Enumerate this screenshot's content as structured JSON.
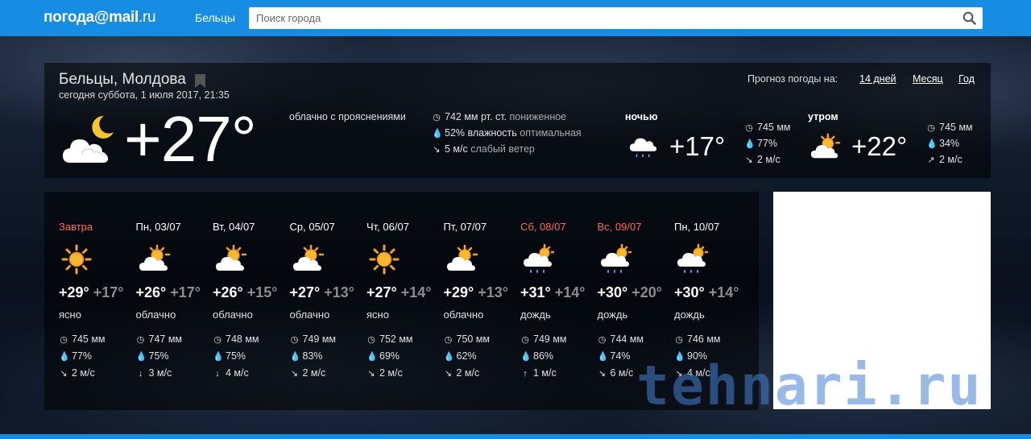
{
  "header": {
    "logo": "погода@mail",
    "logo_suffix": ".ru",
    "city_link": "Бельцы",
    "search_placeholder": "Поиск города"
  },
  "current": {
    "location": "Бельцы, Молдова",
    "date": "сегодня суббота, 1 июля 2017, 21:35",
    "temp": "+27°",
    "condition": "облачно с прояснениями",
    "pressure": "742 мм рт. ст.",
    "pressure_q": "пониженное",
    "humidity": "52% влажность",
    "humidity_q": "оптимальная",
    "wind": "5 м/с",
    "wind_q": "слабый ветер",
    "icon": "partly-cloudy-night-icon"
  },
  "forecast_nav": {
    "label": "Прогноз погоды на:",
    "links": [
      "14 дней",
      "Месяц",
      "Год"
    ]
  },
  "periods": [
    {
      "label": "ночью",
      "temp": "+17°",
      "pressure": "745 мм",
      "humidity": "77%",
      "wind": "2 м/с",
      "wind_arrow": "↘",
      "icon": "cloud-rain-icon"
    },
    {
      "label": "утром",
      "temp": "+22°",
      "pressure": "745 мм",
      "humidity": "34%",
      "wind": "2 м/с",
      "wind_arrow": "↗",
      "icon": "sun-cloud-icon"
    }
  ],
  "days": [
    {
      "name": "Завтра",
      "red": true,
      "hi": "+29°",
      "lo": "+17°",
      "cond": "ясно",
      "icon": "sun",
      "pressure": "745 мм",
      "humidity": "77%",
      "wind": "2 м/с",
      "arrow": "↘"
    },
    {
      "name": "Пн, 03/07",
      "red": false,
      "hi": "+26°",
      "lo": "+17°",
      "cond": "облачно",
      "icon": "suncloud",
      "pressure": "747 мм",
      "humidity": "75%",
      "wind": "3 м/с",
      "arrow": "↓"
    },
    {
      "name": "Вт, 04/07",
      "red": false,
      "hi": "+26°",
      "lo": "+15°",
      "cond": "облачно",
      "icon": "suncloud",
      "pressure": "748 мм",
      "humidity": "75%",
      "wind": "4 м/с",
      "arrow": "↓"
    },
    {
      "name": "Ср, 05/07",
      "red": false,
      "hi": "+27°",
      "lo": "+13°",
      "cond": "облачно",
      "icon": "suncloud",
      "pressure": "749 мм",
      "humidity": "83%",
      "wind": "2 м/с",
      "arrow": "↘"
    },
    {
      "name": "Чт, 06/07",
      "red": false,
      "hi": "+27°",
      "lo": "+14°",
      "cond": "ясно",
      "icon": "sun",
      "pressure": "752 мм",
      "humidity": "69%",
      "wind": "2 м/с",
      "arrow": "↘"
    },
    {
      "name": "Пт, 07/07",
      "red": false,
      "hi": "+29°",
      "lo": "+13°",
      "cond": "облачно",
      "icon": "suncloud",
      "pressure": "750 мм",
      "humidity": "62%",
      "wind": "2 м/с",
      "arrow": "↘"
    },
    {
      "name": "Сб, 08/07",
      "red": true,
      "hi": "+31°",
      "lo": "+14°",
      "cond": "дождь",
      "icon": "rain",
      "pressure": "749 мм",
      "humidity": "86%",
      "wind": "1 м/с",
      "arrow": "↑"
    },
    {
      "name": "Вс, 09/07",
      "red": true,
      "hi": "+30°",
      "lo": "+20°",
      "cond": "дождь",
      "icon": "rain",
      "pressure": "744 мм",
      "humidity": "74%",
      "wind": "6 м/с",
      "arrow": "↘"
    },
    {
      "name": "Пн, 10/07",
      "red": false,
      "hi": "+30°",
      "lo": "+14°",
      "cond": "дождь",
      "icon": "rain",
      "pressure": "746 мм",
      "humidity": "90%",
      "wind": "4 м/с",
      "arrow": "↘"
    }
  ],
  "watermark": "tehnari.ru",
  "colors": {
    "header": "#168de2",
    "sun": "#f5a623",
    "red_day": "#ff6c5c"
  }
}
